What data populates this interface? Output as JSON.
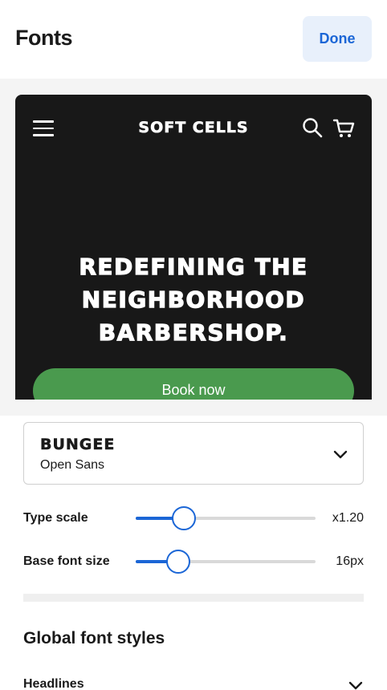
{
  "header": {
    "title": "Fonts",
    "done_label": "Done"
  },
  "preview": {
    "brand": "SOFT CELLS",
    "hero_text": "REDEFINING THE NEIGHBORHOOD BARBERSHOP.",
    "cta_label": "Book now",
    "colors": {
      "background": "#181818",
      "cta": "#4a9a4e",
      "text": "#ffffff"
    }
  },
  "font_select": {
    "primary": "BUNGEE",
    "secondary": "Open Sans"
  },
  "sliders": {
    "type_scale": {
      "label": "Type scale",
      "value": "x1.20",
      "fraction": 0.27
    },
    "base_font_size": {
      "label": "Base font size",
      "value": "16px",
      "fraction": 0.235
    }
  },
  "global_styles": {
    "title": "Global font styles",
    "headlines_label": "Headlines"
  },
  "colors": {
    "accent": "#1b66d6",
    "done_bg": "#e8f0fb"
  }
}
